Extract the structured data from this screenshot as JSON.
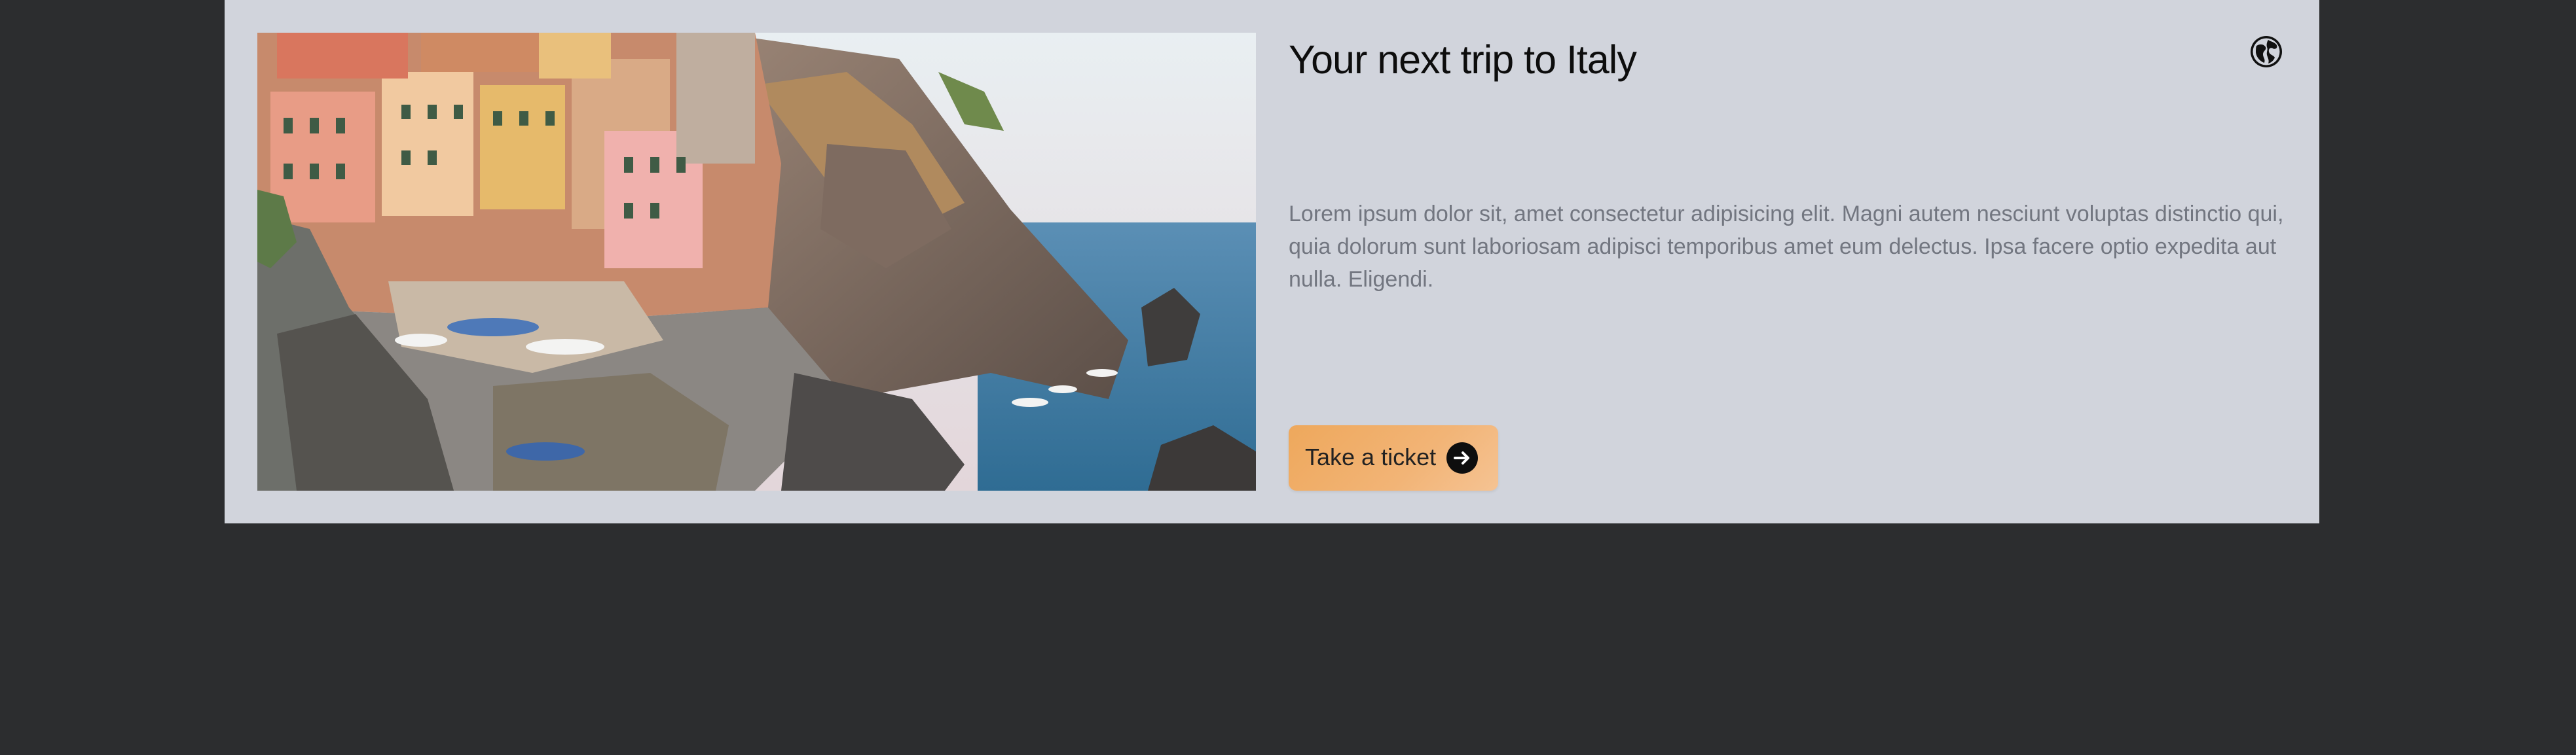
{
  "card": {
    "title": "Your next trip to Italy",
    "description": "Lorem ipsum dolor sit, amet consectetur adipisicing elit. Magni autem nesciunt voluptas distinctio qui, quia dolorum sunt laboriosam adipisci temporibus amet eum delectus. Ipsa facere optio expedita aut nulla. Eligendi.",
    "icon": "globe-icon",
    "image": "coastal-village-photo",
    "button": {
      "label": "Take a ticket",
      "icon": "arrow-right-circle-icon"
    }
  },
  "colors": {
    "page_background": "#2c2d2f",
    "card_background": "#d1d4dc",
    "button_gradient_start": "#eea85c",
    "button_gradient_end": "#f5c393",
    "description_text": "#727680"
  }
}
